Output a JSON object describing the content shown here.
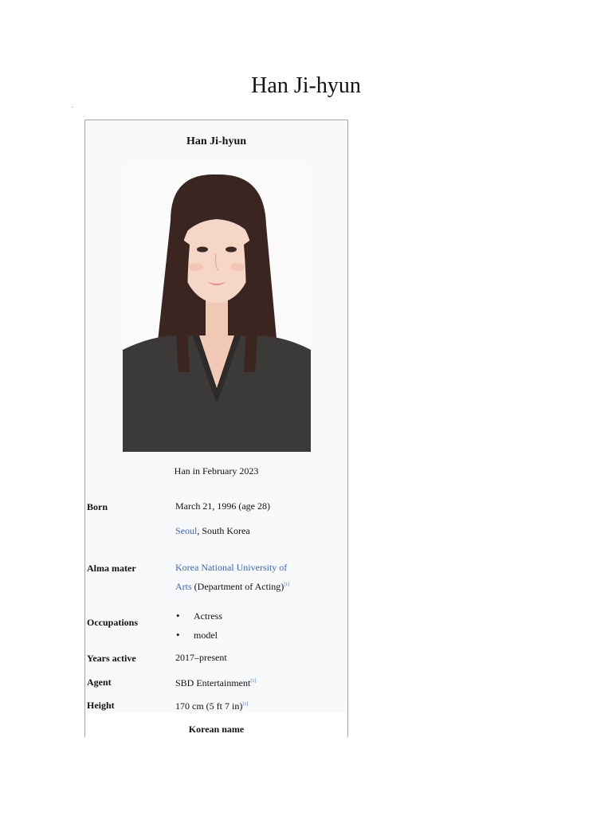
{
  "page": {
    "title": "Han Ji-hyun",
    "mark": "."
  },
  "infobox": {
    "name": "Han Ji-hyun",
    "caption": "Han in February 2023",
    "born": {
      "label": "Born",
      "date": "March 21, 1996 (age 28)",
      "place_link": "Seoul",
      "place_rest": ", South Korea"
    },
    "alma_mater": {
      "label": "Alma mater",
      "link_line1": "Korea National University of",
      "link_line2": "Arts",
      "rest": " (Department of Acting)",
      "ref": "[1]"
    },
    "occupations": {
      "label": "Occupations",
      "items": [
        "Actress",
        "model"
      ]
    },
    "years_active": {
      "label": "Years active",
      "value": "2017–present"
    },
    "agent": {
      "label": "Agent",
      "value": "SBD Entertainment",
      "ref": "[1]"
    },
    "height": {
      "label": "Height",
      "value": "170 cm (5 ft 7 in)",
      "ref": "[1]"
    },
    "korean_name": {
      "label": "Korean name"
    }
  }
}
